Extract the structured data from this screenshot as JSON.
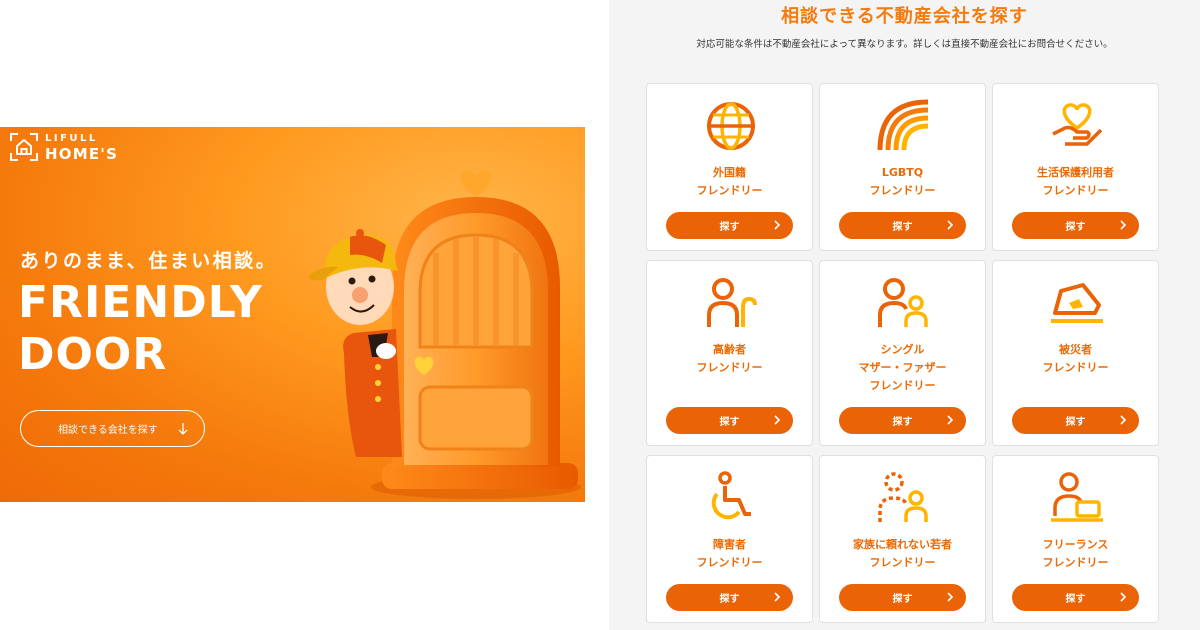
{
  "hero": {
    "logo_top": "LIFULL",
    "logo_bottom": "HOME'S",
    "tagline": "ありのまま、住まい相談。",
    "headline_line1": "FRIENDLY",
    "headline_line2": "DOOR",
    "button_label": "相談できる会社を探す",
    "button_icon": "arrow-down-icon"
  },
  "panel": {
    "title": "相談できる不動産会社を探す",
    "subtitle": "対応可能な条件は不動産会社によって異なります。詳しくは直接不動産会社にお問合せください。",
    "cards": [
      {
        "label": "外国籍\nフレンドリー",
        "button": "探す",
        "icon": "globe-icon"
      },
      {
        "label": "LGBTQ\nフレンドリー",
        "button": "探す",
        "icon": "rainbow-icon"
      },
      {
        "label": "生活保護利用者\nフレンドリー",
        "button": "探す",
        "icon": "heart-hand-icon"
      },
      {
        "label": "高齢者\nフレンドリー",
        "button": "探す",
        "icon": "elderly-cane-icon"
      },
      {
        "label": "シングル\nマザー・ファザー\nフレンドリー",
        "button": "探す",
        "icon": "parent-child-icon"
      },
      {
        "label": "被災者\nフレンドリー",
        "button": "探す",
        "icon": "collapsed-house-icon"
      },
      {
        "label": "障害者\nフレンドリー",
        "button": "探す",
        "icon": "wheelchair-icon"
      },
      {
        "label": "家族に頼れない若者\nフレンドリー",
        "button": "探す",
        "icon": "youth-alone-icon"
      },
      {
        "label": "フリーランス\nフレンドリー",
        "button": "探す",
        "icon": "laptop-person-icon"
      }
    ]
  },
  "colors": {
    "accent": "#ea6306",
    "accent_light": "#ffb400",
    "text_orange": "#f47b0d",
    "panel_bg": "#f4f4f4"
  }
}
